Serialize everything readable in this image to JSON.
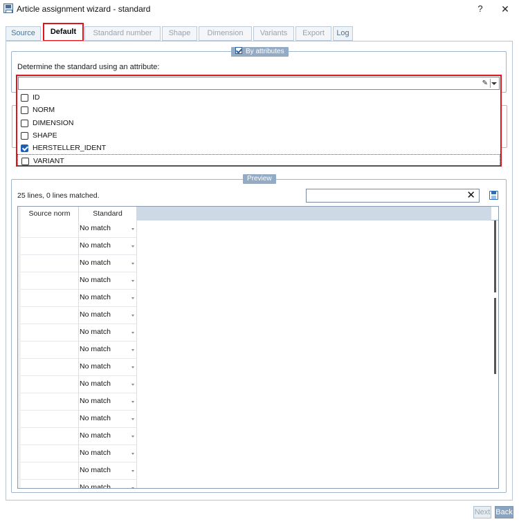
{
  "window": {
    "title": "Article assignment wizard - standard",
    "help": "?",
    "close": "✕"
  },
  "tabs": [
    {
      "label": "Source",
      "state": "enabled"
    },
    {
      "label": "Default",
      "state": "active"
    },
    {
      "label": "Standard number",
      "state": "disabled"
    },
    {
      "label": "Shape",
      "state": "disabled"
    },
    {
      "label": "Dimension",
      "state": "disabled"
    },
    {
      "label": "Variants",
      "state": "disabled"
    },
    {
      "label": "Export",
      "state": "disabled"
    },
    {
      "label": "Log",
      "state": "enabled"
    }
  ],
  "by_attributes": {
    "legend": "By attributes",
    "checked": true,
    "prompt": "Determine the standard using an attribute:",
    "combo_value": "",
    "options": [
      {
        "label": "ID",
        "checked": false
      },
      {
        "label": "NORM",
        "checked": false
      },
      {
        "label": "DIMENSION",
        "checked": false
      },
      {
        "label": "SHAPE",
        "checked": false
      },
      {
        "label": "HERSTELLER_IDENT",
        "checked": true
      },
      {
        "label": "VARIANT",
        "checked": false,
        "focused": true
      }
    ]
  },
  "preview": {
    "legend": "Preview",
    "status": "25 lines, 0 lines matched.",
    "filter_value": "",
    "clear_icon": "✕",
    "columns": [
      "Source norm",
      "Standard"
    ],
    "rows": [
      {
        "source": "",
        "standard": "No match"
      },
      {
        "source": "",
        "standard": "No match"
      },
      {
        "source": "",
        "standard": "No match"
      },
      {
        "source": "",
        "standard": "No match"
      },
      {
        "source": "",
        "standard": "No match"
      },
      {
        "source": "",
        "standard": "No match"
      },
      {
        "source": "",
        "standard": "No match"
      },
      {
        "source": "",
        "standard": "No match"
      },
      {
        "source": "",
        "standard": "No match"
      },
      {
        "source": "",
        "standard": "No match"
      },
      {
        "source": "",
        "standard": "No match"
      },
      {
        "source": "",
        "standard": "No match"
      },
      {
        "source": "",
        "standard": "No match"
      },
      {
        "source": "",
        "standard": "No match"
      },
      {
        "source": "",
        "standard": "No match"
      },
      {
        "source": "",
        "standard": "No match"
      }
    ]
  },
  "footer": {
    "next": "Next",
    "back": "Back"
  },
  "colors": {
    "highlight": "#e0141b",
    "accent": "#1f5fb3",
    "legend_bg": "#93abc5"
  }
}
